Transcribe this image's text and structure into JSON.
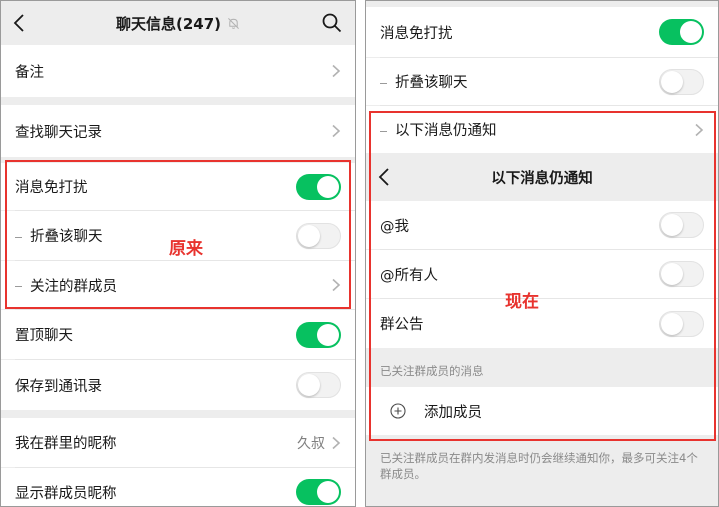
{
  "left": {
    "header": {
      "title": "聊天信息(247)"
    },
    "rows": {
      "remark": "备注",
      "find_history": "查找聊天记录",
      "mute": "消息免打扰",
      "fold": "折叠该聊天",
      "followed_members": "关注的群成员",
      "pin": "置顶聊天",
      "save_contacts": "保存到通讯录",
      "my_nickname": "我在群里的昵称",
      "my_nickname_value": "久叔",
      "show_nicknames": "显示群成员昵称"
    },
    "annotation": "原来"
  },
  "right": {
    "rows": {
      "mute": "消息免打扰",
      "fold": "折叠该聊天",
      "still_notify": "以下消息仍通知",
      "at_me": "@我",
      "at_all": "@所有人",
      "group_notice": "群公告",
      "add_member": "添加成员"
    },
    "subpage_title": "以下消息仍通知",
    "section_caption": "已关注群成员的消息",
    "footnote": "已关注群成员在群内发消息时仍会继续通知你，最多可关注4个群成员。",
    "annotation": "现在"
  },
  "colors": {
    "accent_green": "#07c160",
    "annotation_red": "#e8332e",
    "background": "#ededed"
  },
  "toggles": {
    "left_mute": true,
    "left_fold": false,
    "left_pin": true,
    "left_save": false,
    "left_show_nick": true,
    "right_mute": true,
    "right_fold": false,
    "right_at_me": false,
    "right_at_all": false,
    "right_notice": false
  }
}
